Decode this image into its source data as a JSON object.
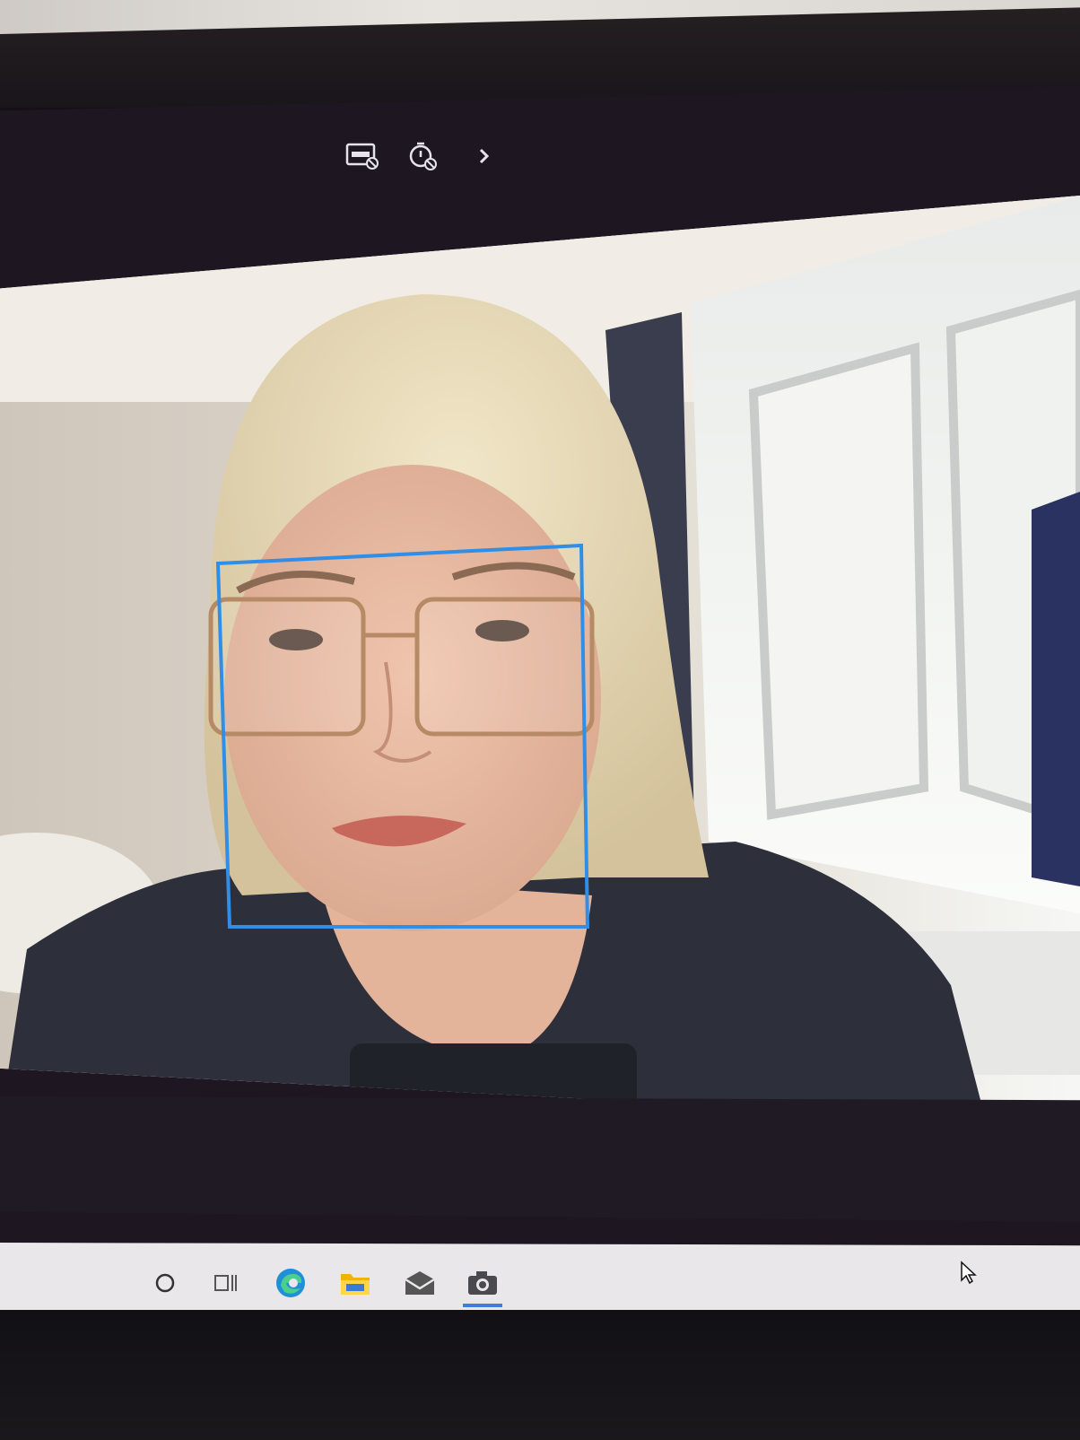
{
  "app": {
    "name": "Camera"
  },
  "toolbar": {
    "hdr_icon": "hdr-off-icon",
    "timer_icon": "photo-timer-off-icon",
    "more_icon": "chevron-right-icon"
  },
  "preview": {
    "face_box_color": "#2f8fe8"
  },
  "taskbar": {
    "items": [
      {
        "icon": "cortana-circle-icon"
      },
      {
        "icon": "task-view-icon"
      },
      {
        "icon": "edge-icon"
      },
      {
        "icon": "file-explorer-icon"
      },
      {
        "icon": "mail-icon"
      },
      {
        "icon": "camera-icon",
        "active": true
      }
    ]
  },
  "colors": {
    "accent": "#3d7fd6",
    "taskbar": "#e9e7ea",
    "window": "#1e1721"
  }
}
